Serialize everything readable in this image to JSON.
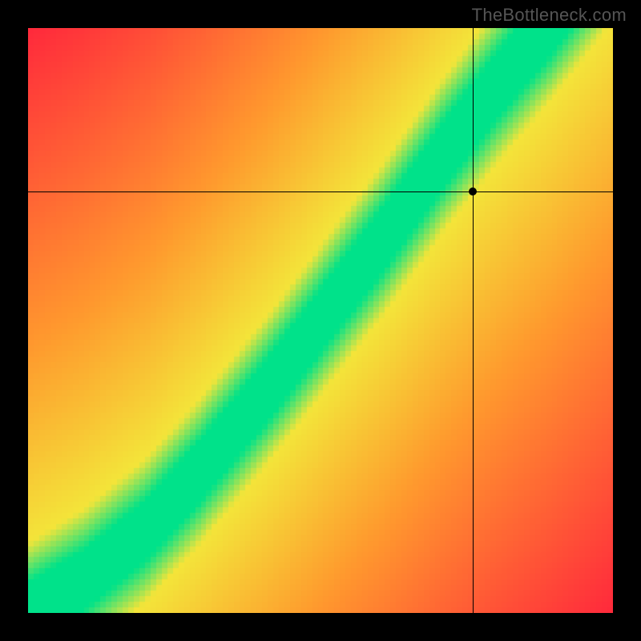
{
  "watermark": "TheBottleneck.com",
  "chart_data": {
    "type": "heatmap",
    "title": "",
    "xlabel": "",
    "ylabel": "",
    "xlim": [
      0,
      1
    ],
    "ylim": [
      0,
      1
    ],
    "legend": false,
    "description": "Diagonal green optimal band on red-to-yellow gradient field; crosshair marks selected configuration.",
    "ridge": [
      {
        "x": 0.0,
        "y": 0.0
      },
      {
        "x": 0.1,
        "y": 0.06
      },
      {
        "x": 0.2,
        "y": 0.14
      },
      {
        "x": 0.3,
        "y": 0.25
      },
      {
        "x": 0.4,
        "y": 0.37
      },
      {
        "x": 0.5,
        "y": 0.5
      },
      {
        "x": 0.6,
        "y": 0.63
      },
      {
        "x": 0.7,
        "y": 0.77
      },
      {
        "x": 0.8,
        "y": 0.9
      },
      {
        "x": 0.9,
        "y": 1.02
      },
      {
        "x": 1.0,
        "y": 1.15
      }
    ],
    "crosshair": {
      "x": 0.76,
      "y": 0.72
    },
    "colors": {
      "optimal": "#00e28a",
      "near": "#f4e53a",
      "mid": "#ff9a2e",
      "far": "#ff2a3c"
    }
  }
}
